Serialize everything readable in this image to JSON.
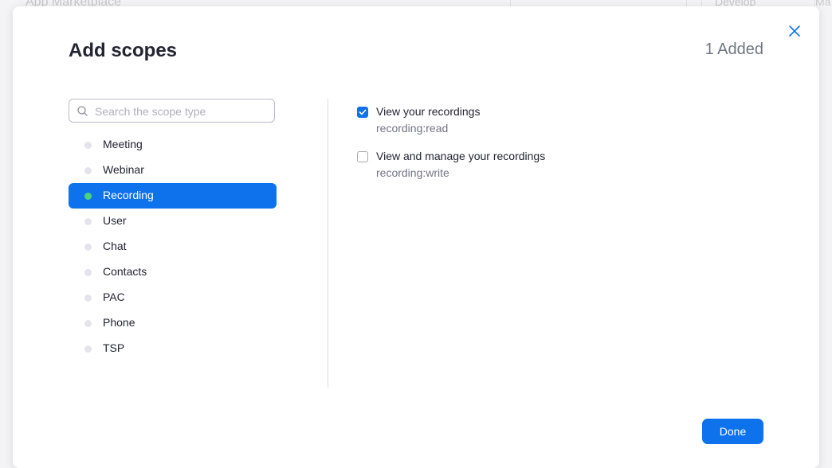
{
  "background": {
    "title": "App Marketplace",
    "develop_label": "Develop",
    "partial_label": "Ma"
  },
  "modal": {
    "title": "Add scopes",
    "added_count": "1 Added",
    "close_icon": "close-icon",
    "search": {
      "placeholder": "Search the scope type",
      "value": "",
      "icon": "search-icon"
    },
    "scope_types": [
      {
        "label": "Meeting",
        "active": false
      },
      {
        "label": "Webinar",
        "active": false
      },
      {
        "label": "Recording",
        "active": true
      },
      {
        "label": "User",
        "active": false
      },
      {
        "label": "Chat",
        "active": false
      },
      {
        "label": "Contacts",
        "active": false
      },
      {
        "label": "PAC",
        "active": false
      },
      {
        "label": "Phone",
        "active": false
      },
      {
        "label": "TSP",
        "active": false
      }
    ],
    "permissions": [
      {
        "title": "View your recordings",
        "scope": "recording:read",
        "checked": true
      },
      {
        "title": "View and manage your recordings",
        "scope": "recording:write",
        "checked": false
      }
    ],
    "done_label": "Done"
  },
  "colors": {
    "accent": "#0e72ed",
    "active_dot": "#4cd37c",
    "inactive_dot": "#e4e4ea"
  }
}
